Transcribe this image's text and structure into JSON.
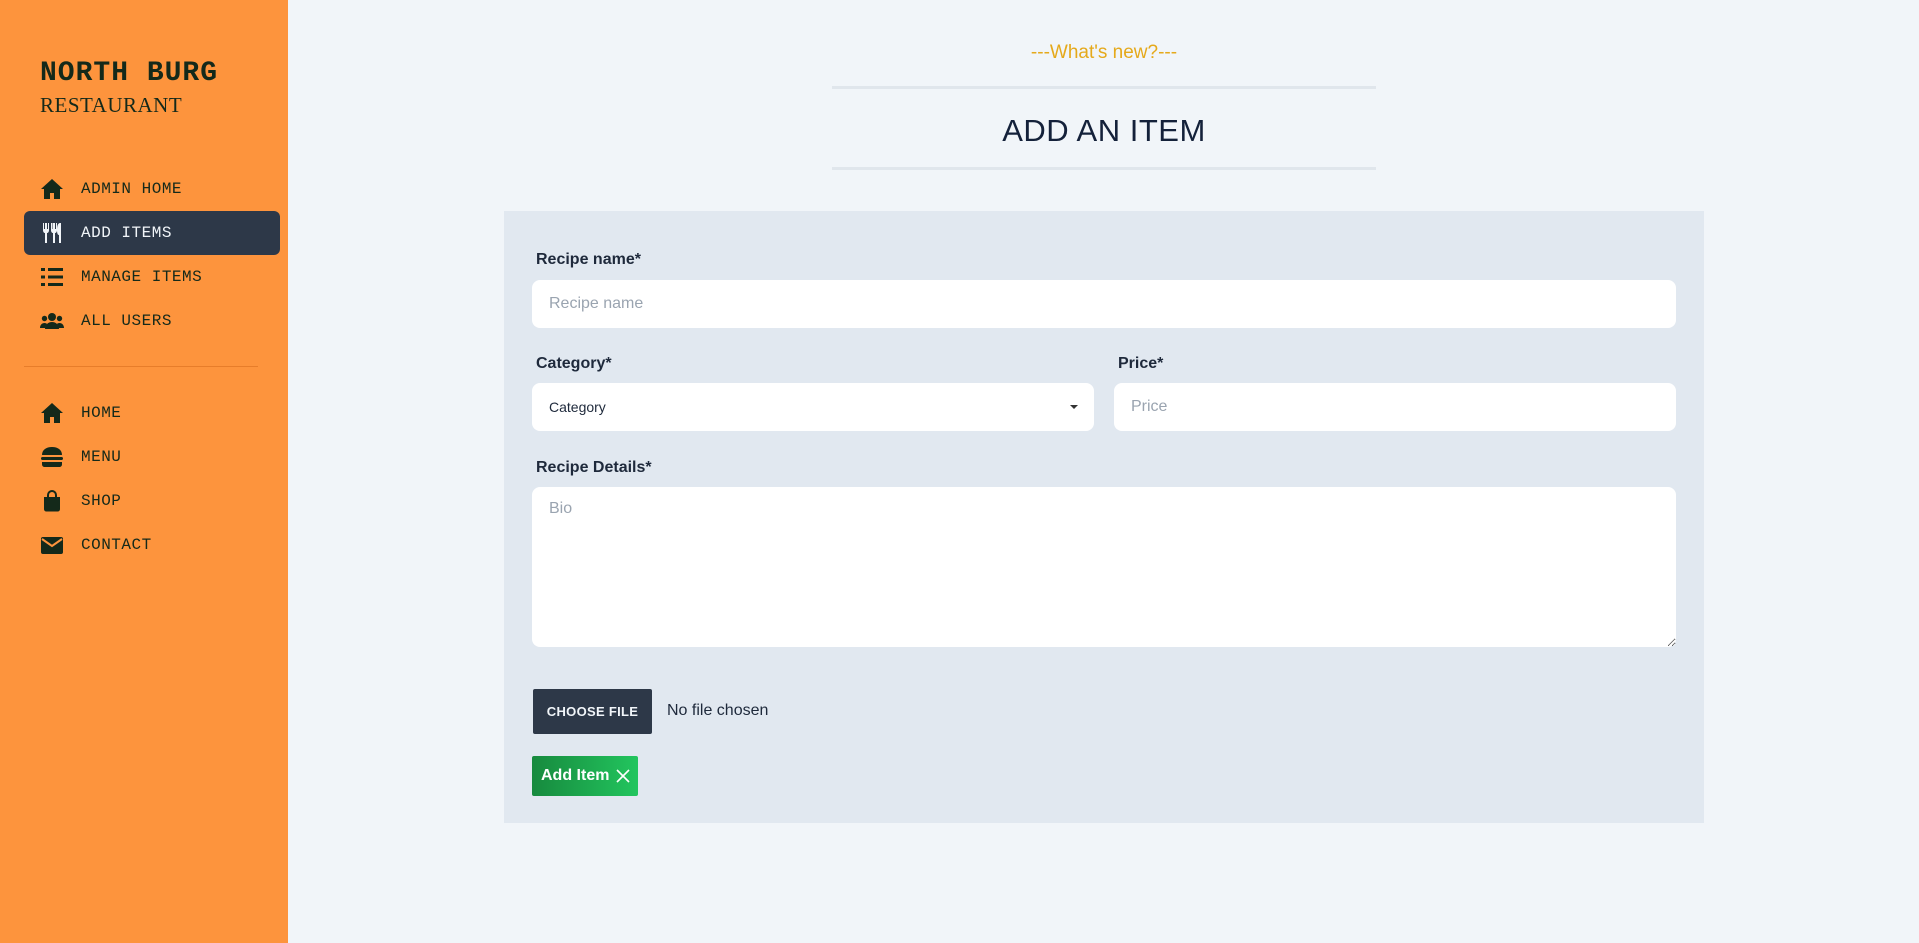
{
  "brand": {
    "title": "NORTH BURG",
    "subtitle": "RESTAURANT"
  },
  "sidebar": {
    "admin_items": [
      {
        "label": "ADMIN HOME",
        "icon": "home-icon",
        "active": false
      },
      {
        "label": "ADD ITEMS",
        "icon": "utensils-icon",
        "active": true
      },
      {
        "label": "MANAGE ITEMS",
        "icon": "list-icon",
        "active": false
      },
      {
        "label": "ALL USERS",
        "icon": "users-icon",
        "active": false
      }
    ],
    "site_items": [
      {
        "label": "HOME",
        "icon": "home-icon"
      },
      {
        "label": "MENU",
        "icon": "burger-icon"
      },
      {
        "label": "SHOP",
        "icon": "shopping-bag-icon"
      },
      {
        "label": "CONTACT",
        "icon": "envelope-icon"
      }
    ]
  },
  "header": {
    "subheading": "---What's new?---",
    "title": "ADD AN ITEM"
  },
  "form": {
    "recipe_name": {
      "label": "Recipe name*",
      "placeholder": "Recipe name",
      "value": ""
    },
    "category": {
      "label": "Category*",
      "selected": "Category"
    },
    "price": {
      "label": "Price*",
      "placeholder": "Price",
      "value": ""
    },
    "details": {
      "label": "Recipe Details*",
      "placeholder": "Bio",
      "value": ""
    },
    "file": {
      "button_label": "CHOOSE FILE",
      "status": "No file chosen"
    },
    "submit_label": "Add Item"
  },
  "colors": {
    "sidebar_bg": "#fd943d",
    "active_item_bg": "#2d3848",
    "accent_yellow": "#e5a91b",
    "submit_green": "#22c55e",
    "form_bg": "#e1e8f0",
    "page_bg": "#f1f5f9"
  }
}
